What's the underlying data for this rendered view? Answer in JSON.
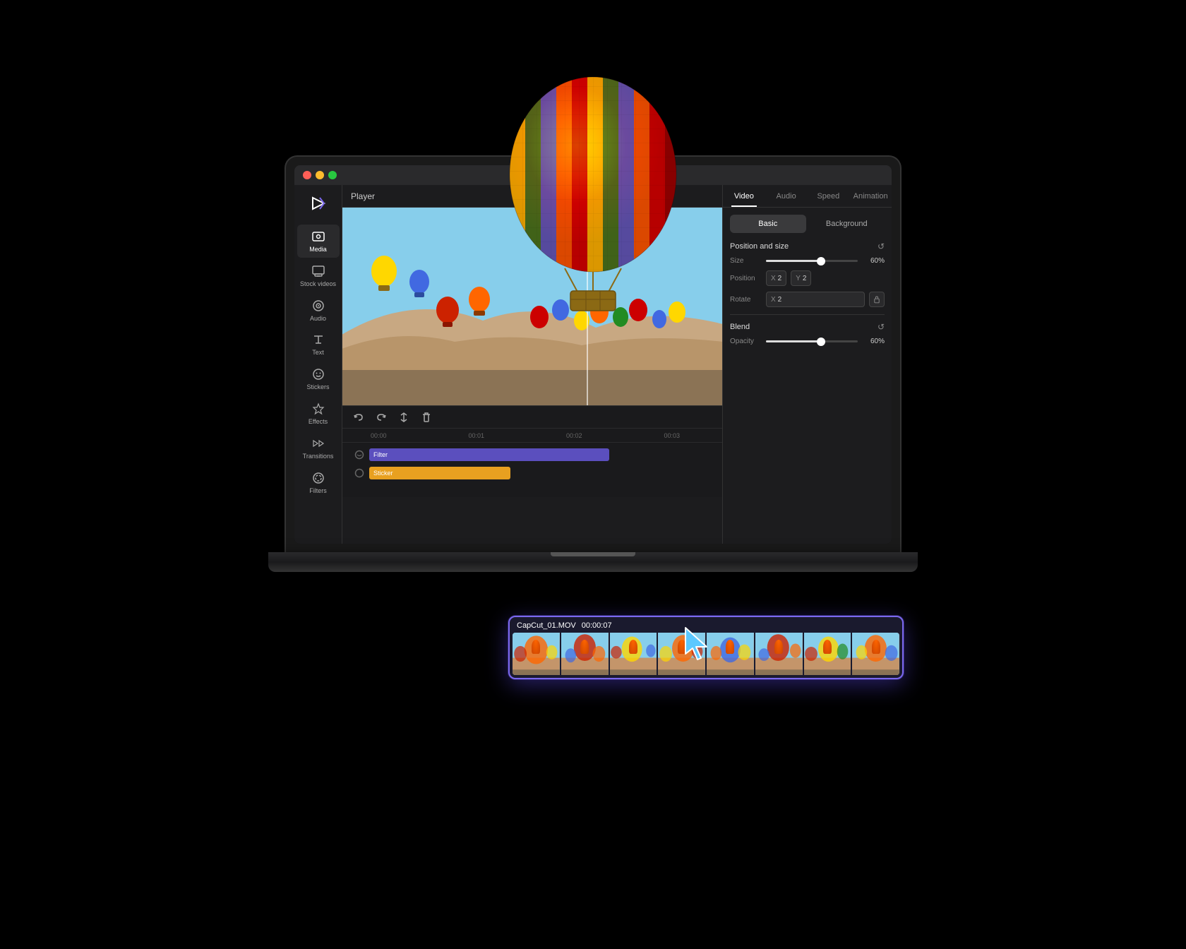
{
  "app": {
    "title": "CapCut",
    "player_label": "Player"
  },
  "traffic_lights": {
    "red": "#ff5f57",
    "yellow": "#febc2e",
    "green": "#28c840"
  },
  "sidebar": {
    "items": [
      {
        "id": "media",
        "label": "Media",
        "icon": "media"
      },
      {
        "id": "stock-videos",
        "label": "Stock videos",
        "icon": "stock"
      },
      {
        "id": "audio",
        "label": "Audio",
        "icon": "audio"
      },
      {
        "id": "text",
        "label": "Text",
        "icon": "text"
      },
      {
        "id": "stickers",
        "label": "Stickers",
        "icon": "stickers"
      },
      {
        "id": "effects",
        "label": "Effects",
        "icon": "effects"
      },
      {
        "id": "transitions",
        "label": "Transitions",
        "icon": "transitions"
      },
      {
        "id": "filters",
        "label": "Filters",
        "icon": "filters"
      }
    ],
    "active": "media"
  },
  "right_panel": {
    "tabs": [
      "Video",
      "Audio",
      "Speed",
      "Animation"
    ],
    "active_tab": "Video",
    "sub_tabs": [
      "Basic",
      "Background"
    ],
    "active_sub": "Basic",
    "sections": {
      "position_size": {
        "label": "Position and size",
        "size": {
          "value": "60%",
          "fill_pct": 60
        },
        "position": {
          "x": "2",
          "y": "2"
        },
        "rotate": {
          "x": "2"
        }
      },
      "blend": {
        "label": "Blend",
        "opacity": {
          "value": "60%",
          "fill_pct": 60
        }
      }
    }
  },
  "timeline": {
    "controls": [
      "undo",
      "redo",
      "split",
      "delete"
    ],
    "ruler": [
      "00:00",
      "00:01",
      "00:02",
      "00:03"
    ],
    "tracks": [
      {
        "id": "filter",
        "label": "Filter",
        "color": "#5B4FBE"
      },
      {
        "id": "sticker",
        "label": "Sticker",
        "color": "#E8A020"
      }
    ]
  },
  "floating_clip": {
    "filename": "CapCut_01.MOV",
    "duration": "00:00:07",
    "border_color": "#7B68EE"
  }
}
